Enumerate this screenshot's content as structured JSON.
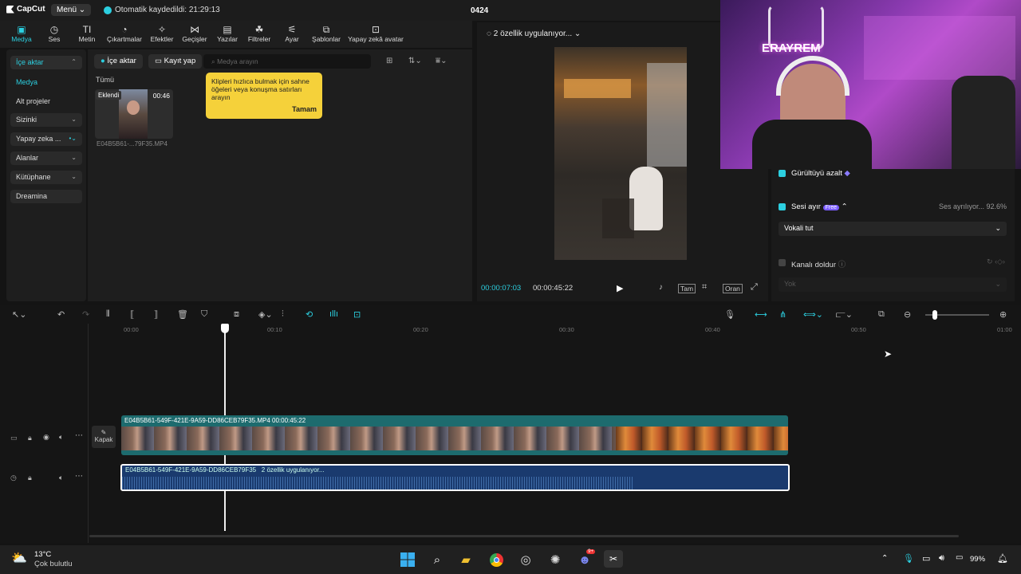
{
  "app": {
    "name": "CapCut",
    "menu": "Menü",
    "autosave": "Otomatik kaydedildi: 21:29:13",
    "project": "0424"
  },
  "toolbar": [
    "Medya",
    "Ses",
    "Metin",
    "Çıkartmalar",
    "Efektler",
    "Geçişler",
    "Yazılar",
    "Filtreler",
    "Ayar",
    "Şablonlar",
    "Yapay zekâ avatar"
  ],
  "toolbar_icons": [
    "media-icon",
    "audio-icon",
    "text-icon",
    "sticker-icon",
    "effects-icon",
    "transitions-icon",
    "captions-icon",
    "filters-icon",
    "adjust-icon",
    "templates-icon",
    "ai-avatar-icon"
  ],
  "leftnav": {
    "import": "İçe aktar",
    "media": "Medya",
    "subprojects": "Alt projeler",
    "yours": "Sizinki",
    "ai": "Yapay zeka ...",
    "spaces": "Alanlar",
    "library": "Kütüphane",
    "dreamina": "Dreamina"
  },
  "media": {
    "import_btn": "İçe aktar",
    "record_btn": "Kayıt yap",
    "search_placeholder": "Medya arayın",
    "filter_all": "Tümü",
    "tooltip_text": "Klipleri hızlıca bulmak için sahne öğeleri veya konuşma satırları arayın",
    "tooltip_ok": "Tamam",
    "clip_badge": "Eklendi",
    "clip_duration": "00:46",
    "clip_name": "E04B5B61-...79F35.MP4"
  },
  "preview": {
    "status": "2 özellik uygulanıyor...",
    "current_time": "00:00:07:03",
    "total_time": "00:00:45:22",
    "full_btn": "Tam",
    "ratio_btn": "Oran"
  },
  "props": {
    "noise": "Gürültüyü azalt",
    "separate": "Sesi ayır",
    "free_badge": "Free",
    "progress_text": "Ses ayrılıyor... 92.6%",
    "vocal_select": "Vokali tut",
    "fill_channel": "Kanalı doldur",
    "none_select": "Yok"
  },
  "webcam_overlay": "ERAYREM",
  "timeline": {
    "ruler": [
      "00:00",
      "00:10",
      "00:20",
      "00:30",
      "00:40",
      "00:50",
      "01:00"
    ],
    "video_clip": "E04B5B61-549F-421E-9A59-DD86CEB79F35.MP4   00:00:45:22",
    "audio_clip": "E04B5B61-549F-421E-9A59-DD86CEB79F35",
    "audio_status": "2 özellik uygulanıyor...",
    "cover_label": "Kapak"
  },
  "taskbar": {
    "temp": "13°C",
    "weather": "Çok bulutlu",
    "battery": "99%",
    "discord_badge": "9+"
  },
  "colors": {
    "accent": "#2ccfe0",
    "video_track": "#1d6b6e",
    "audio_track": "#1a3a6e",
    "tooltip": "#f5d13a"
  }
}
